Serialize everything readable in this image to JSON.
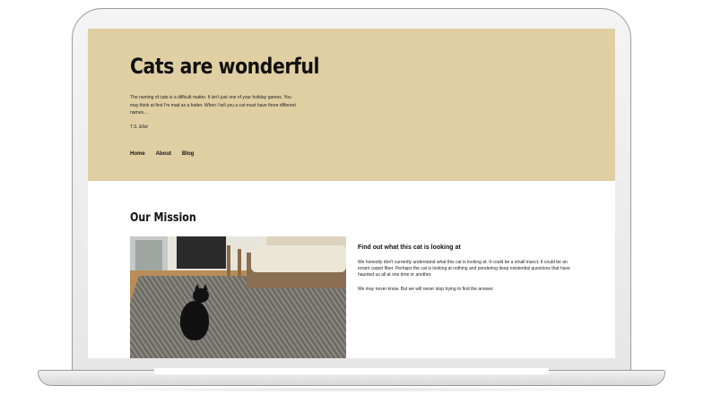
{
  "site": {
    "title": "Cats are wonderful",
    "quote": "The naming of cats is a difficult matter. It isn't just one of your holiday games. You may think at first I'm mad as a hatter. When I tell you a cat must have three different names...",
    "author": "T.S. Eliot",
    "nav": [
      "Home",
      "About",
      "Blog"
    ],
    "colors": {
      "hero_background": "#dfcfa3",
      "page_background": "#ffffff"
    }
  },
  "mission": {
    "heading": "Our Mission",
    "photo_icon": "black-cat-on-rug-photo",
    "article_title": "Find out what this cat is looking at",
    "paragraph_1": "We honestly don't currently understand what this cat is looking at. It could be a small insect. It could be an errant carpet fiber. Perhaps the cat is looking at nothing and pondering deep existential questions that have haunted us all at one time or another.",
    "paragraph_2": "We may never know. But we will never stop trying to find the answer."
  }
}
